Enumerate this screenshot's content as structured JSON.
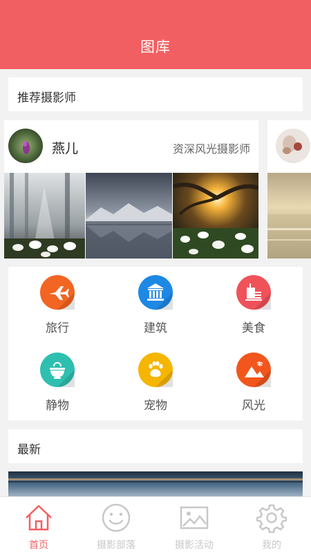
{
  "header": {
    "title": "图库"
  },
  "sections": {
    "recommend_title": "推荐摄影师",
    "latest_title": "最新"
  },
  "photographers": [
    {
      "name": "燕儿",
      "tagline": "资深风光摄影师"
    },
    {
      "name": "",
      "tagline": ""
    }
  ],
  "categories": [
    {
      "label": "旅行",
      "icon": "airplane-icon",
      "color": "#f26522"
    },
    {
      "label": "建筑",
      "icon": "building-icon",
      "color": "#1e88e5"
    },
    {
      "label": "美食",
      "icon": "food-icon",
      "color": "#f0525a"
    },
    {
      "label": "静物",
      "icon": "still-life-icon",
      "color": "#2fbfb0"
    },
    {
      "label": "宠物",
      "icon": "paw-icon",
      "color": "#f6b500"
    },
    {
      "label": "风光",
      "icon": "landscape-icon",
      "color": "#f2561d"
    }
  ],
  "tabbar": {
    "items": [
      {
        "label": "首页",
        "icon": "home-icon",
        "active": true
      },
      {
        "label": "摄影部落",
        "icon": "smiley-icon",
        "active": false
      },
      {
        "label": "摄影活动",
        "icon": "picture-icon",
        "active": false
      },
      {
        "label": "我的",
        "icon": "gear-icon",
        "active": false
      }
    ],
    "active_color": "#f25f62",
    "inactive_color": "#c8c8c8"
  },
  "colors": {
    "brand": "#f25f62",
    "background": "#f2f2f2"
  }
}
